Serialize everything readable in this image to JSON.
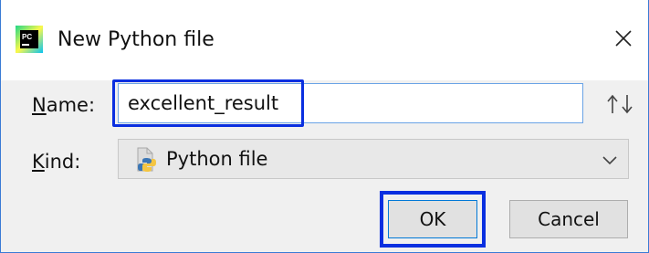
{
  "window": {
    "title": "New Python file",
    "app_icon": "pycharm-logo",
    "close_icon": "close-icon"
  },
  "form": {
    "name_label_accel": "N",
    "name_label_rest": "ame:",
    "name_value": "excellent_result",
    "kind_label_accel": "K",
    "kind_label_rest": "ind:",
    "kind_value": "Python file",
    "kind_icon": "python-file-icon"
  },
  "buttons": {
    "ok_label": "OK",
    "cancel_label": "Cancel"
  },
  "colors": {
    "highlight": "#0a2fe0",
    "focus_border": "#6aa3e6"
  }
}
